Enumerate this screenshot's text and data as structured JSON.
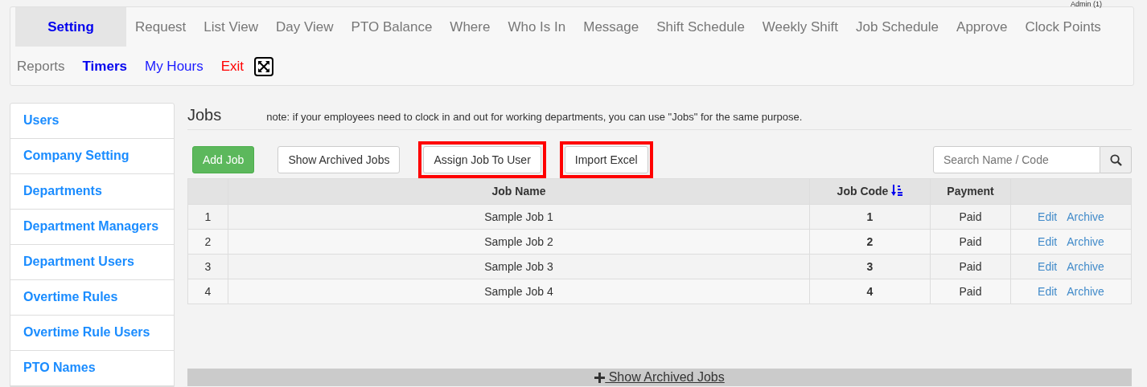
{
  "user_label": "Admin (1)",
  "primary_tabs": [
    {
      "label": "Setting",
      "selected": true
    },
    {
      "label": "Request",
      "selected": false
    },
    {
      "label": "List View",
      "selected": false
    },
    {
      "label": "Day View",
      "selected": false
    },
    {
      "label": "PTO Balance",
      "selected": false
    },
    {
      "label": "Where",
      "selected": false
    },
    {
      "label": "Who Is In",
      "selected": false
    },
    {
      "label": "Message",
      "selected": false
    },
    {
      "label": "Shift Schedule",
      "selected": false
    },
    {
      "label": "Weekly Shift",
      "selected": false
    },
    {
      "label": "Job Schedule",
      "selected": false
    },
    {
      "label": "Approve",
      "selected": false
    },
    {
      "label": "Clock Points",
      "selected": false
    }
  ],
  "secondary_links": [
    {
      "label": "Reports",
      "kind": "plain"
    },
    {
      "label": "Timers",
      "kind": "strong"
    },
    {
      "label": "My Hours",
      "kind": "link"
    },
    {
      "label": "Exit",
      "kind": "danger"
    },
    {
      "kind": "fullscreen"
    }
  ],
  "sidebar": {
    "items": [
      "Users",
      "Company Setting",
      "Departments",
      "Department Managers",
      "Department Users",
      "Overtime Rules",
      "Overtime Rule Users",
      "PTO Names"
    ]
  },
  "page": {
    "title": "Jobs",
    "note": "note: if your employees need to clock in and out for working departments, you can use \"Jobs\" for the same purpose."
  },
  "toolbar": {
    "buttons": [
      {
        "label": "Add Job",
        "kind": "success",
        "highlighted": false
      },
      {
        "label": "Show Archived Jobs",
        "kind": "default",
        "highlighted": false
      },
      {
        "label": "Assign Job To User",
        "kind": "default",
        "highlighted": true
      },
      {
        "label": "Import Excel",
        "kind": "default",
        "highlighted": true
      }
    ],
    "search": {
      "placeholder": "Search Name / Code"
    }
  },
  "table": {
    "columns": [
      {
        "sorted": false
      },
      {
        "label": "Job Name",
        "sorted": false
      },
      {
        "label": "Job Code",
        "sorted": true
      },
      {
        "label": "Payment",
        "sorted": false
      },
      {
        "sorted": false
      }
    ],
    "rows": [
      {
        "index": "1",
        "name": "Sample Job 1",
        "code": "1",
        "payment": "Paid",
        "actions": [
          "Edit",
          "Archive"
        ]
      },
      {
        "index": "2",
        "name": "Sample Job 2",
        "code": "2",
        "payment": "Paid",
        "actions": [
          "Edit",
          "Archive"
        ]
      },
      {
        "index": "3",
        "name": "Sample Job 3",
        "code": "3",
        "payment": "Paid",
        "actions": [
          "Edit",
          "Archive"
        ]
      },
      {
        "index": "4",
        "name": "Sample Job 4",
        "code": "4",
        "payment": "Paid",
        "actions": [
          "Edit",
          "Archive"
        ]
      }
    ]
  },
  "footer_toggle": {
    "label": " Show Archived Jobs"
  }
}
